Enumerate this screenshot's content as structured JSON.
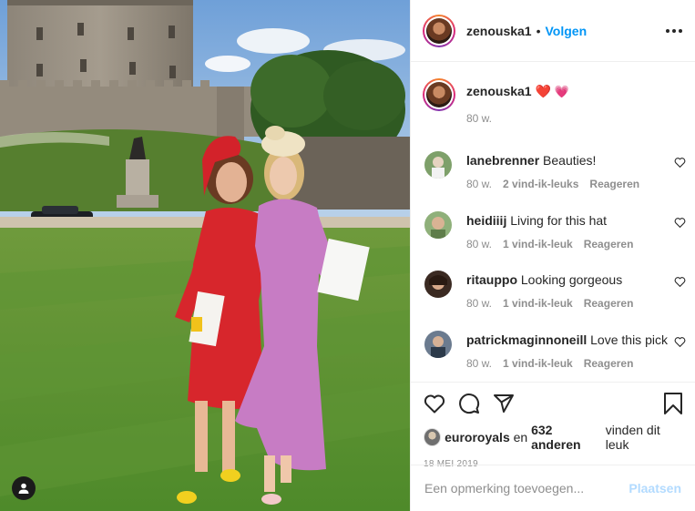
{
  "post": {
    "author": "zenouska1",
    "separator": "•",
    "follow_label": "Volgen",
    "more_icon": "more-horizontal-icon",
    "user_tag_icon": "user-tag-icon"
  },
  "caption": {
    "username": "zenouska1",
    "emojis": [
      "❤️",
      "💗"
    ],
    "age": "80 w."
  },
  "comments": [
    {
      "username": "lanebrenner",
      "text": "Beauties!",
      "age": "80 w.",
      "likes": "2 vind-ik-leuks",
      "reply": "Reageren"
    },
    {
      "username": "heidiiij",
      "text": "Living for this hat",
      "age": "80 w.",
      "likes": "1 vind-ik-leuk",
      "reply": "Reageren"
    },
    {
      "username": "ritauppo",
      "text": "Looking gorgeous",
      "age": "80 w.",
      "likes": "1 vind-ik-leuk",
      "reply": "Reageren"
    },
    {
      "username": "patrickmaginnoneill",
      "text": "Love this pick",
      "age": "80 w.",
      "likes": "1 vind-ik-leuk",
      "reply": "Reageren"
    }
  ],
  "actions": {
    "icons": [
      "heart-icon",
      "comment-icon",
      "share-icon",
      "bookmark-icon"
    ]
  },
  "likes": {
    "first_user": "euroroyals",
    "joiner": "en",
    "count": "632 anderen",
    "suffix": "vinden dit leuk"
  },
  "date": "18 MEI 2019",
  "add_comment": {
    "placeholder": "Een opmerking toevoegen...",
    "post_label": "Plaatsen"
  },
  "colors": {
    "link": "#0095f6",
    "muted": "#8e8e8e",
    "post_disabled": "#b3dbff",
    "heart": "#ed4956"
  }
}
